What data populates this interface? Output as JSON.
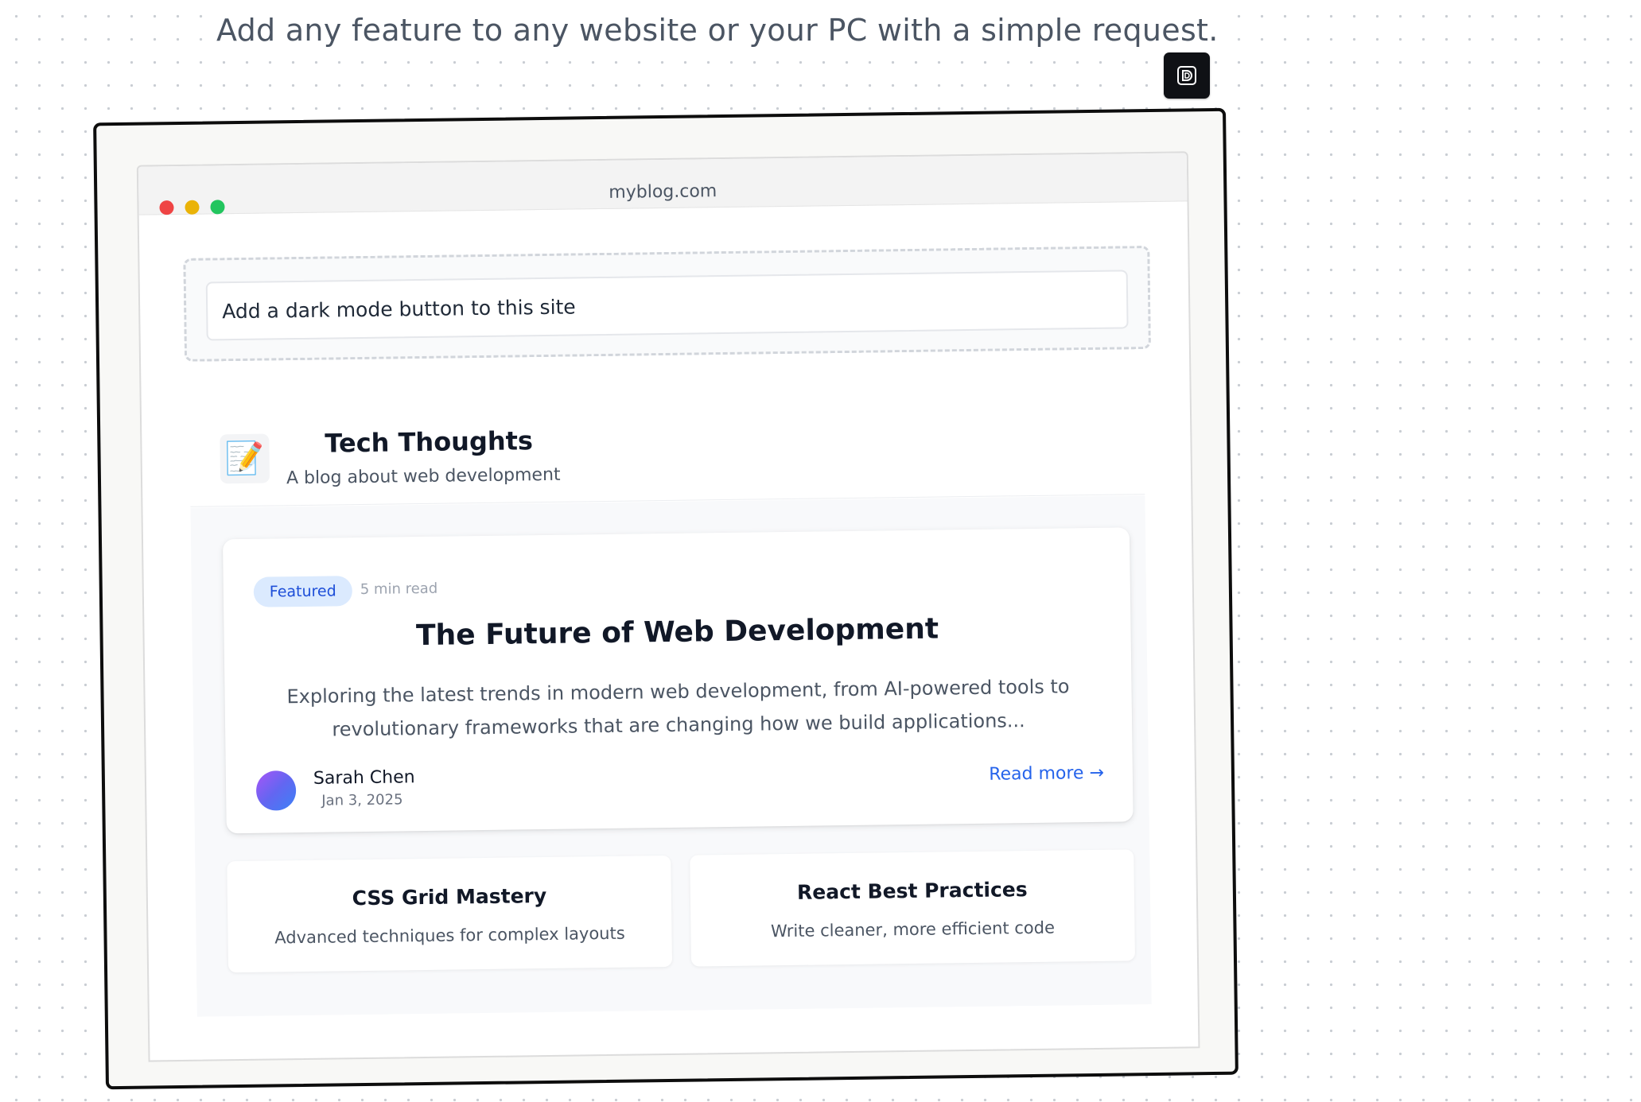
{
  "tagline": "Add any feature to any website or your PC with a simple request.",
  "badge_icon": "d-logo-icon",
  "browser": {
    "url": "myblog.com",
    "window_dots": [
      "#ef4444",
      "#eab308",
      "#22c55e"
    ]
  },
  "prompt": {
    "text": "Add a dark mode button to this site"
  },
  "blog": {
    "icon": "📝",
    "title": "Tech Thoughts",
    "subtitle": "A blog about web development"
  },
  "featured": {
    "badge": "Featured",
    "read_time": "5 min read",
    "title": "The Future of Web Development",
    "excerpt": "Exploring the latest trends in modern web development, from AI-powered tools to revolutionary frameworks that are changing how we build applications...",
    "author": "Sarah Chen",
    "date": "Jan 3, 2025",
    "read_more": "Read more →"
  },
  "cards": [
    {
      "title": "CSS Grid Mastery",
      "description": "Advanced techniques for complex layouts"
    },
    {
      "title": "React Best Practices",
      "description": "Write cleaner, more efficient code"
    }
  ],
  "colors": {
    "accent": "#2563eb",
    "badge_bg": "#dbeafe",
    "frame_border": "#0d0d0d"
  }
}
